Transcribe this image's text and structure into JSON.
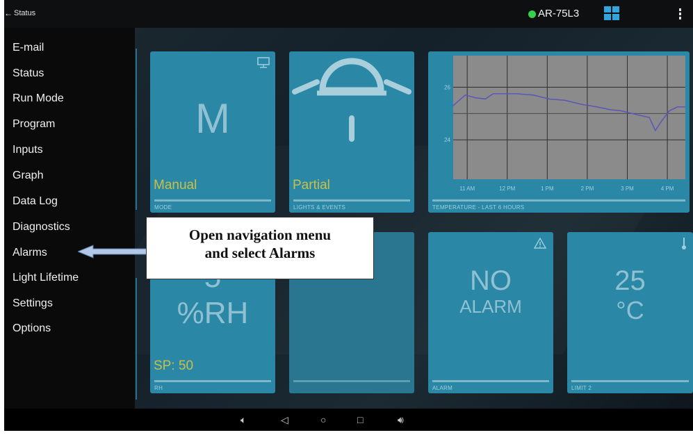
{
  "topbar": {
    "back_label": "Status",
    "device_id": "AR-75L3",
    "status_color": "#35d04b",
    "accent": "#2fa6df"
  },
  "menu": {
    "items": [
      {
        "label": "E-mail"
      },
      {
        "label": "Status"
      },
      {
        "label": "Run Mode"
      },
      {
        "label": "Program"
      },
      {
        "label": "Inputs"
      },
      {
        "label": "Graph"
      },
      {
        "label": "Data Log"
      },
      {
        "label": "Diagnostics"
      },
      {
        "label": "Alarms"
      },
      {
        "label": "Light Lifetime"
      },
      {
        "label": "Settings"
      },
      {
        "label": "Options"
      }
    ]
  },
  "tiles": {
    "mode": {
      "big": "M",
      "value": "Manual",
      "caption": "MODE",
      "icon": "monitor-icon"
    },
    "lights": {
      "value": "Partial",
      "caption": "LIGHTS & EVENTS",
      "icon": "lamp-icon"
    },
    "temp": {
      "caption": "TEMPERATURE - LAST 6 HOURS"
    },
    "rh": {
      "big1": "5",
      "big2": "%RH",
      "value": "SP: 50",
      "caption": "RH"
    },
    "alarm": {
      "big1": "NO",
      "big2": "ALARM",
      "caption": "ALARM",
      "icon": "warning-icon"
    },
    "limit": {
      "big1": "25",
      "big2": "°C",
      "caption": "LIMIT 2",
      "icon": "thermometer-icon"
    }
  },
  "chart_data": {
    "type": "line",
    "x_ticks": [
      "11 AM",
      "12 PM",
      "1 PM",
      "2 PM",
      "3 PM",
      "4 PM"
    ],
    "y_ticks": [
      "24",
      "26"
    ],
    "ylim": [
      22.5,
      27.2
    ],
    "x": [
      0.0,
      0.3,
      0.55,
      0.8,
      1.0,
      1.3,
      1.6,
      2.0,
      2.4,
      2.8,
      3.2,
      3.6,
      3.9,
      4.2,
      4.6,
      4.9,
      5.05,
      5.2,
      5.4,
      5.6,
      5.8
    ],
    "y": [
      25.3,
      25.7,
      25.6,
      25.55,
      25.75,
      25.75,
      25.75,
      25.7,
      25.55,
      25.5,
      25.35,
      25.25,
      25.15,
      25.1,
      24.95,
      24.85,
      24.35,
      24.7,
      25.1,
      25.25,
      25.25
    ],
    "x_range": [
      0,
      5.8
    ],
    "grid": true,
    "line_color": "#5a56b8"
  },
  "callout": {
    "line1": "Open navigation menu",
    "line2": "and select Alarms"
  },
  "navbar": {
    "icons": [
      "volume-down-icon",
      "back-icon",
      "home-icon",
      "recents-icon",
      "volume-up-icon"
    ]
  }
}
